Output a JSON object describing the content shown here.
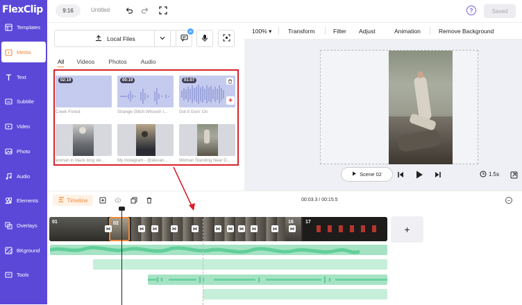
{
  "app": {
    "logo": "FlexClip",
    "aspect_ratio": "9:16",
    "title": "Untitled",
    "saved": "Saved",
    "help": "?"
  },
  "sidebar": {
    "items": [
      {
        "label": "Templates",
        "icon": "templates-icon"
      },
      {
        "label": "Media",
        "icon": "media-icon",
        "active": true
      },
      {
        "label": "Text",
        "icon": "text-icon"
      },
      {
        "label": "Subtitle",
        "icon": "subtitle-icon"
      },
      {
        "label": "Video",
        "icon": "video-icon"
      },
      {
        "label": "Photo",
        "icon": "photo-icon"
      },
      {
        "label": "Audio",
        "icon": "audio-icon"
      },
      {
        "label": "Elements",
        "icon": "elements-icon"
      },
      {
        "label": "Overlays",
        "icon": "overlays-icon"
      },
      {
        "label": "BKground",
        "icon": "background-icon"
      },
      {
        "label": "Tools",
        "icon": "tools-icon"
      }
    ]
  },
  "media_panel": {
    "local_files": "Local Files",
    "ai_badge": "AI",
    "tabs": [
      "All",
      "Videos",
      "Photos",
      "Audio"
    ],
    "items": [
      {
        "type": "audio",
        "duration": "02:19",
        "label": "Creek Forest"
      },
      {
        "type": "audio",
        "duration": "00:19",
        "label": "Strange Glitch Whoosh I..."
      },
      {
        "type": "audio",
        "duration": "01:07",
        "label": "Got It Goin' On"
      },
      {
        "type": "video",
        "duration": "",
        "label": "woman in black long sle..."
      },
      {
        "type": "video",
        "duration": "",
        "label": "My Instagram - @alexan..."
      },
      {
        "type": "video",
        "duration": "",
        "label": "Woman Standing Near D..."
      }
    ]
  },
  "preview_toolbar": {
    "zoom": "100%",
    "items": [
      "Transform",
      "Filter",
      "Adjust",
      "Animation",
      "Remove Background"
    ]
  },
  "player": {
    "scene": "Scene 02",
    "duration": "1.5s"
  },
  "timeline": {
    "label": "Timeline",
    "time": "00:03.3 / 00:15.5",
    "clip_numbers": [
      "01",
      "02",
      "16",
      "17"
    ],
    "add": "+"
  },
  "colors": {
    "sidebar": "#5b48d9",
    "accent": "#f08a3c",
    "highlight": "#d9202a",
    "audio": "#a6e3c4"
  }
}
